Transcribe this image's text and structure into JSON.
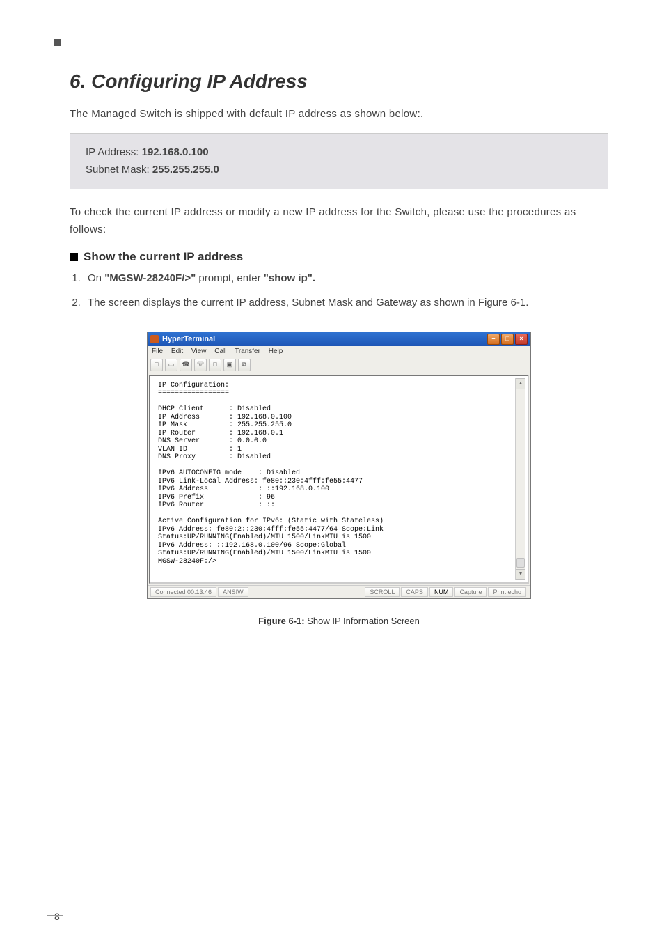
{
  "section": {
    "title": "6. Configuring IP Address",
    "intro": "The Managed Switch is shipped with default IP address as shown below:."
  },
  "ip_block": {
    "ip_label": "IP Address: ",
    "ip_value": "192.168.0.100",
    "mask_label": "Subnet Mask: ",
    "mask_value": "255.255.255.0"
  },
  "body2": "To check the current IP address or modify a new IP address for the Switch, please use the procedures as follows:",
  "sub_heading": "Show the current IP address",
  "step1": {
    "prefix": "On ",
    "prompt": "\"MGSW-28240F/>\"",
    "mid": " prompt, enter ",
    "cmd": "\"show ip\"."
  },
  "step2": "The screen displays the current IP address, Subnet Mask and Gateway as shown in Figure 6-1.",
  "terminal": {
    "title": "HyperTerminal",
    "menus": [
      "File",
      "Edit",
      "View",
      "Call",
      "Transfer",
      "Help"
    ],
    "toolbar_icons": [
      "□",
      "▭",
      "☎",
      "☏",
      "□",
      "▣",
      "⧉"
    ],
    "content": "IP Configuration:\n=================\n\nDHCP Client      : Disabled\nIP Address       : 192.168.0.100\nIP Mask          : 255.255.255.0\nIP Router        : 192.168.0.1\nDNS Server       : 0.0.0.0\nVLAN ID          : 1\nDNS Proxy        : Disabled\n\nIPv6 AUTOCONFIG mode    : Disabled\nIPv6 Link-Local Address: fe80::230:4fff:fe55:4477\nIPv6 Address            : ::192.168.0.100\nIPv6 Prefix             : 96\nIPv6 Router             : ::\n\nActive Configuration for IPv6: (Static with Stateless)\nIPv6 Address: fe80:2::230:4fff:fe55:4477/64 Scope:Link\nStatus:UP/RUNNING(Enabled)/MTU 1500/LinkMTU is 1500\nIPv6 Address: ::192.168.0.100/96 Scope:Global\nStatus:UP/RUNNING(Enabled)/MTU 1500/LinkMTU is 1500\nMGSW-28240F:/>",
    "status": {
      "connected": "Connected 00:13:46",
      "encoding": "ANSIW",
      "scroll": "SCROLL",
      "caps": "CAPS",
      "num": "NUM",
      "capture": "Capture",
      "echo": "Print echo"
    }
  },
  "figure": {
    "label": "Figure 6-1:",
    "caption": "Show IP Information Screen"
  },
  "page_number": "8"
}
